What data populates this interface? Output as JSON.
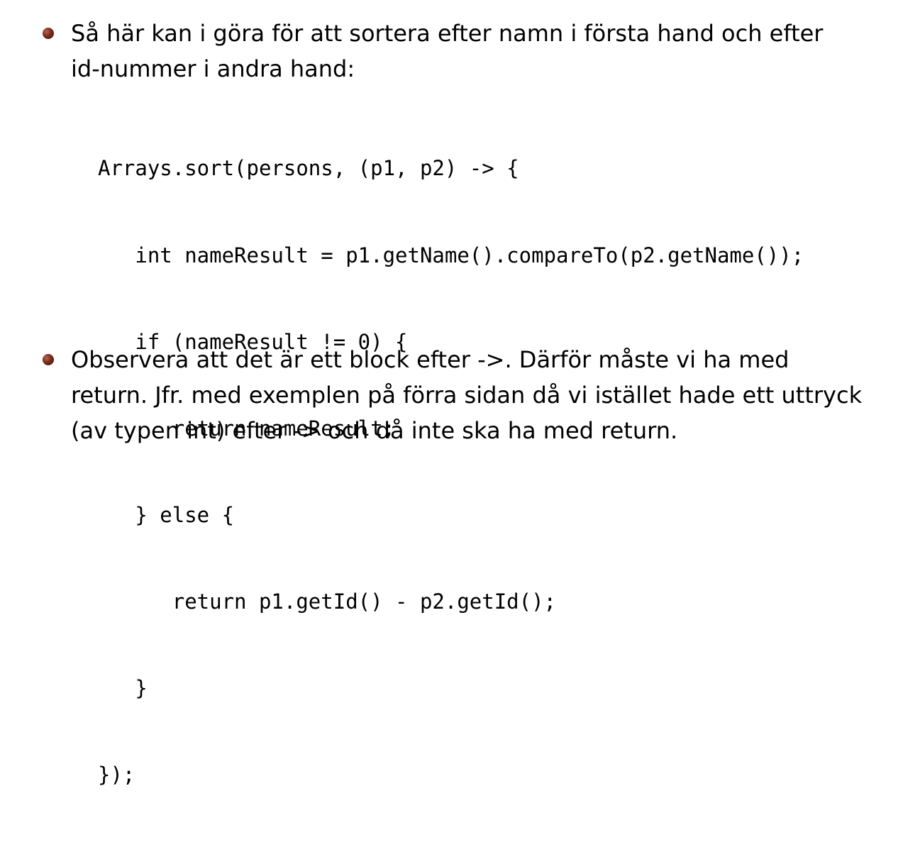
{
  "bullets": [
    {
      "lines": [
        "Så här kan i göra för att sortera efter namn i första hand och efter",
        "id-nummer i andra hand:"
      ]
    },
    {
      "lines": [
        "Observera att det är ett block efter ->. Därför måste vi ha med",
        "return. Jfr. med exemplen på förra sidan då vi istället hade ett uttryck",
        "(av typen int) efter -> och då inte ska ha med return."
      ]
    }
  ],
  "code": {
    "lines": [
      "Arrays.sort(persons, (p1, p2) -> {",
      "   int nameResult = p1.getName().compareTo(p2.getName());",
      "   if (nameResult != 0) {",
      "      return nameResult;",
      "   } else {",
      "      return p1.getId() - p2.getId();",
      "   }",
      "});"
    ]
  },
  "colors": {
    "bullet": "#7a2a18",
    "text": "#000000",
    "background": "#ffffff"
  }
}
